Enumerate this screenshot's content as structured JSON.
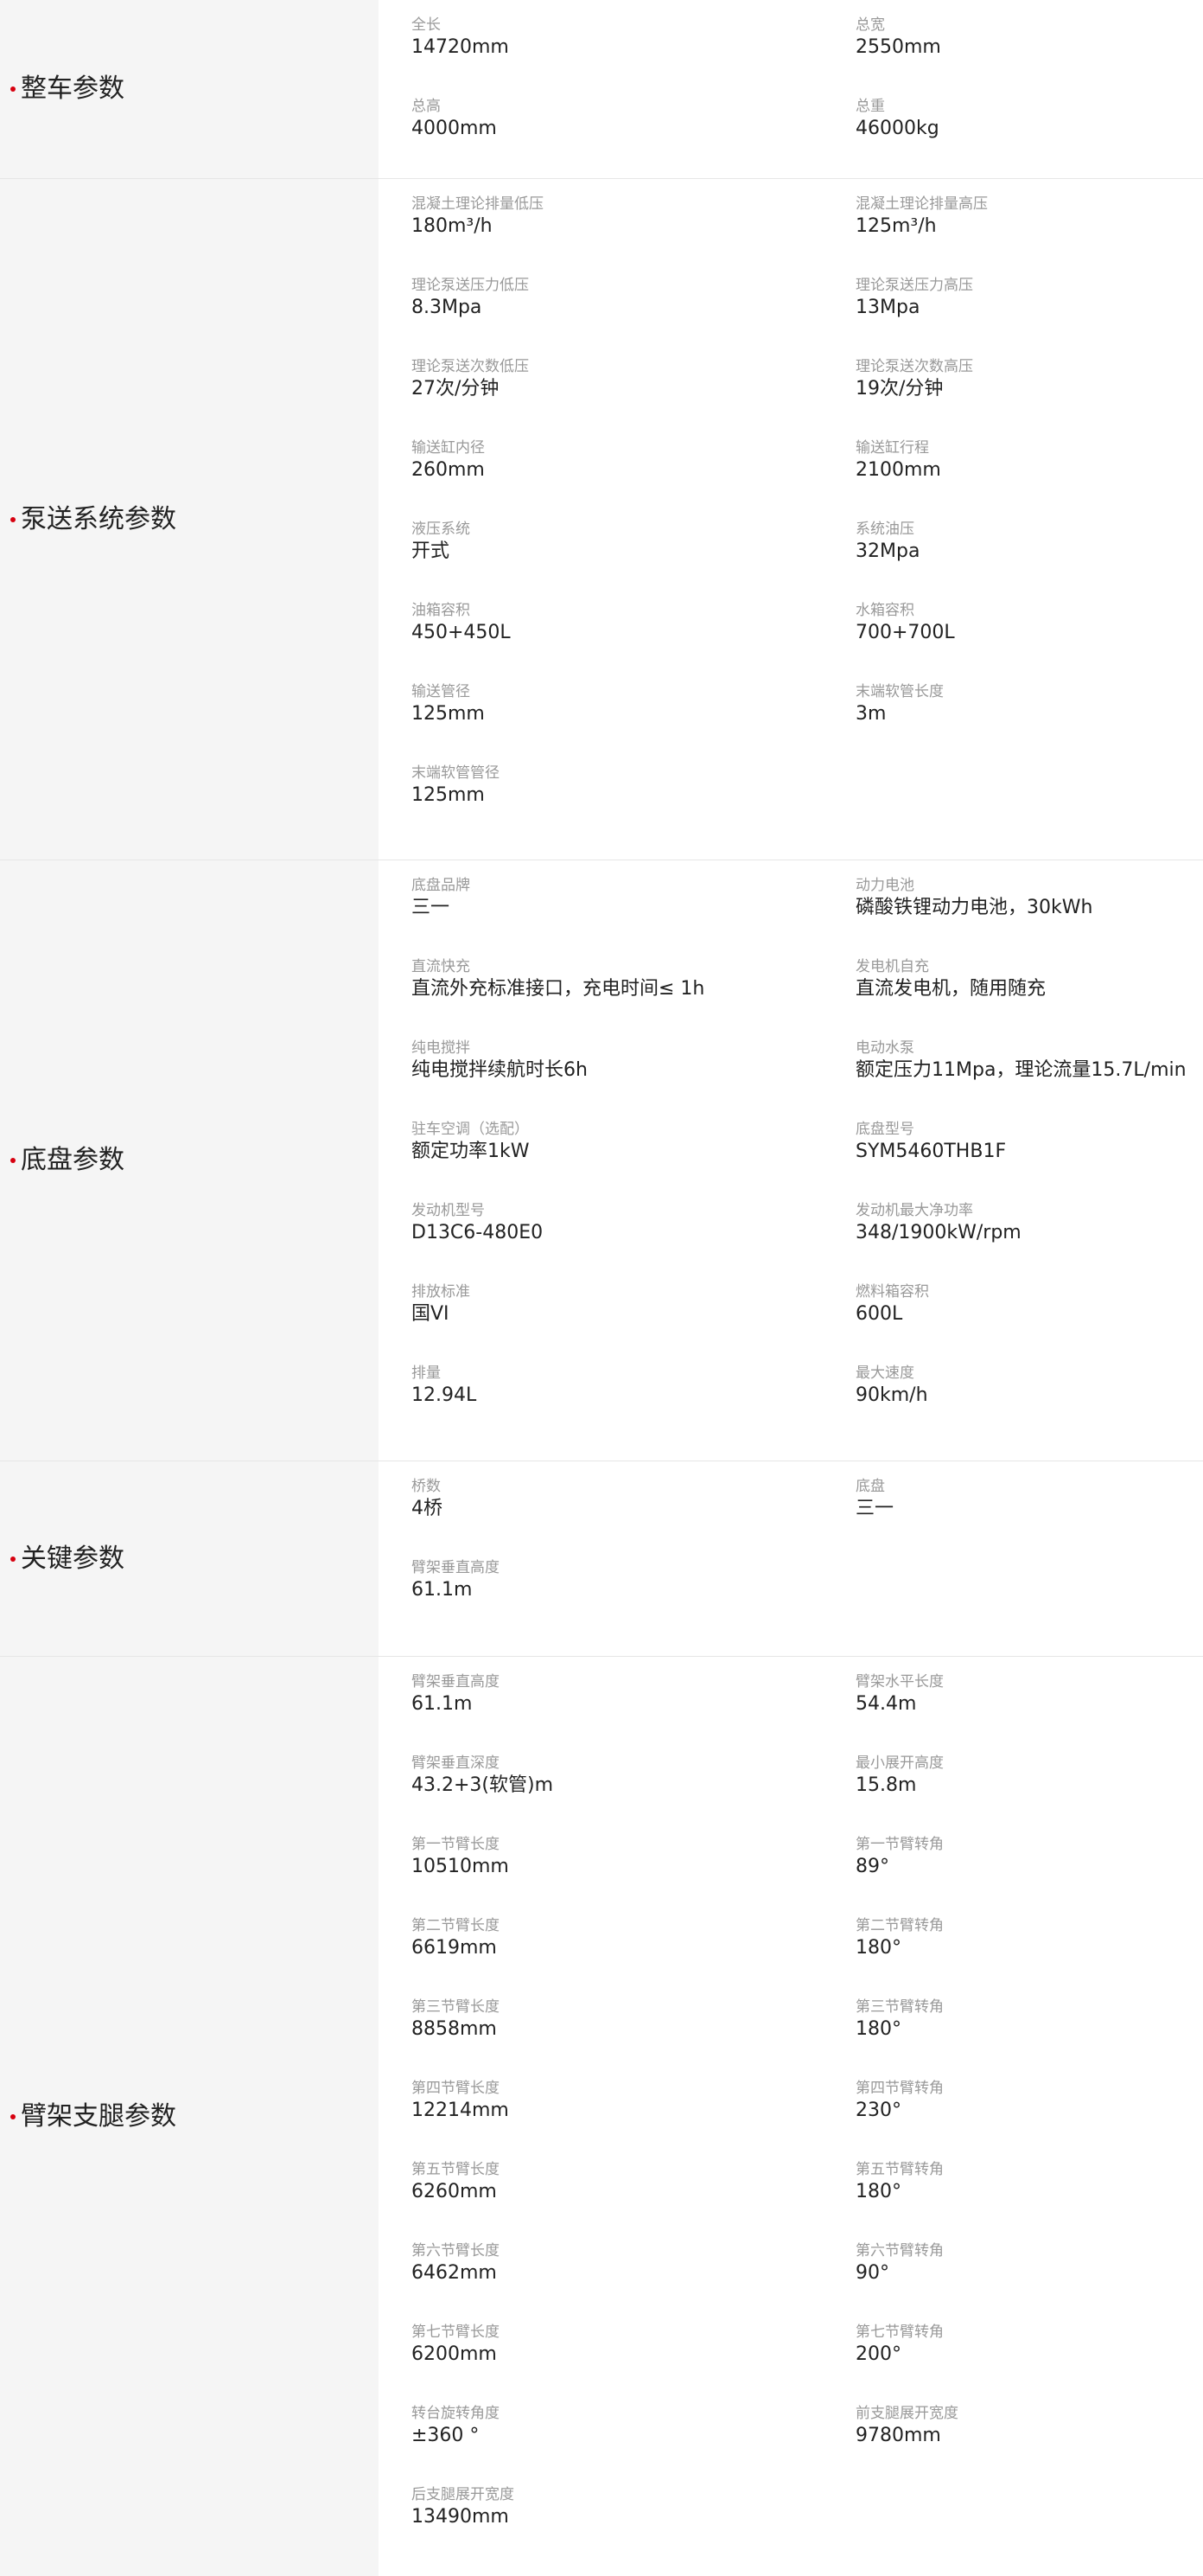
{
  "sections": [
    {
      "title": "整车参数",
      "items": [
        {
          "label": "全长",
          "value": "14720mm"
        },
        {
          "label": "总宽",
          "value": "2550mm"
        },
        {
          "label": "总高",
          "value": "4000mm"
        },
        {
          "label": "总重",
          "value": "46000kg"
        }
      ]
    },
    {
      "title": "泵送系统参数",
      "items": [
        {
          "label": "混凝土理论排量低压",
          "value": "180m³/h"
        },
        {
          "label": "混凝土理论排量高压",
          "value": "125m³/h"
        },
        {
          "label": "理论泵送压力低压",
          "value": "8.3Mpa"
        },
        {
          "label": "理论泵送压力高压",
          "value": "13Mpa"
        },
        {
          "label": "理论泵送次数低压",
          "value": "27次/分钟"
        },
        {
          "label": "理论泵送次数高压",
          "value": "19次/分钟"
        },
        {
          "label": "输送缸内径",
          "value": "260mm"
        },
        {
          "label": "输送缸行程",
          "value": "2100mm"
        },
        {
          "label": "液压系统",
          "value": "开式"
        },
        {
          "label": "系统油压",
          "value": "32Mpa"
        },
        {
          "label": "油箱容积",
          "value": "450+450L"
        },
        {
          "label": "水箱容积",
          "value": "700+700L"
        },
        {
          "label": "输送管径",
          "value": "125mm"
        },
        {
          "label": "末端软管长度",
          "value": "3m"
        },
        {
          "label": "末端软管管径",
          "value": "125mm"
        }
      ]
    },
    {
      "title": "底盘参数",
      "items": [
        {
          "label": "底盘品牌",
          "value": "三一"
        },
        {
          "label": "动力电池",
          "value": "磷酸铁锂动力电池，30kWh"
        },
        {
          "label": "直流快充",
          "value": "直流外充标准接口，充电时间≤ 1h"
        },
        {
          "label": "发电机自充",
          "value": "直流发电机，随用随充"
        },
        {
          "label": "纯电搅拌",
          "value": "纯电搅拌续航时长6h"
        },
        {
          "label": "电动水泵",
          "value": "额定压力11Mpa，理论流量15.7L/min"
        },
        {
          "label": "驻车空调（选配）",
          "value": "额定功率1kW"
        },
        {
          "label": "底盘型号",
          "value": "SYM5460THB1F"
        },
        {
          "label": "发动机型号",
          "value": "D13C6-480E0"
        },
        {
          "label": "发动机最大净功率",
          "value": "348/1900kW/rpm"
        },
        {
          "label": "排放标准",
          "value": "国VI"
        },
        {
          "label": "燃料箱容积",
          "value": "600L"
        },
        {
          "label": "排量",
          "value": "12.94L"
        },
        {
          "label": "最大速度",
          "value": "90km/h"
        }
      ]
    },
    {
      "title": "关键参数",
      "items": [
        {
          "label": "桥数",
          "value": "4桥"
        },
        {
          "label": "底盘",
          "value": "三一"
        },
        {
          "label": "臂架垂直高度",
          "value": "61.1m"
        }
      ]
    },
    {
      "title": "臂架支腿参数",
      "items": [
        {
          "label": "臂架垂直高度",
          "value": "61.1m"
        },
        {
          "label": "臂架水平长度",
          "value": "54.4m"
        },
        {
          "label": "臂架垂直深度",
          "value": "43.2+3(软管)m"
        },
        {
          "label": "最小展开高度",
          "value": "15.8m"
        },
        {
          "label": "第一节臂长度",
          "value": "10510mm"
        },
        {
          "label": "第一节臂转角",
          "value": "89°"
        },
        {
          "label": "第二节臂长度",
          "value": "6619mm"
        },
        {
          "label": "第二节臂转角",
          "value": "180°"
        },
        {
          "label": "第三节臂长度",
          "value": "8858mm"
        },
        {
          "label": "第三节臂转角",
          "value": "180°"
        },
        {
          "label": "第四节臂长度",
          "value": "12214mm"
        },
        {
          "label": "第四节臂转角",
          "value": "230°"
        },
        {
          "label": "第五节臂长度",
          "value": "6260mm"
        },
        {
          "label": "第五节臂转角",
          "value": "180°"
        },
        {
          "label": "第六节臂长度",
          "value": "6462mm"
        },
        {
          "label": "第六节臂转角",
          "value": "90°"
        },
        {
          "label": "第七节臂长度",
          "value": "6200mm"
        },
        {
          "label": "第七节臂转角",
          "value": "200°"
        },
        {
          "label": "转台旋转角度",
          "value": "±360 °"
        },
        {
          "label": "前支腿展开宽度",
          "value": "9780mm"
        },
        {
          "label": "后支腿展开宽度",
          "value": "13490mm"
        }
      ]
    }
  ],
  "colors": {
    "accent": "#d7000f",
    "head_bg": "#f5f5f5",
    "label": "#999999",
    "value": "#222222",
    "divider": "#e6e6e6"
  }
}
